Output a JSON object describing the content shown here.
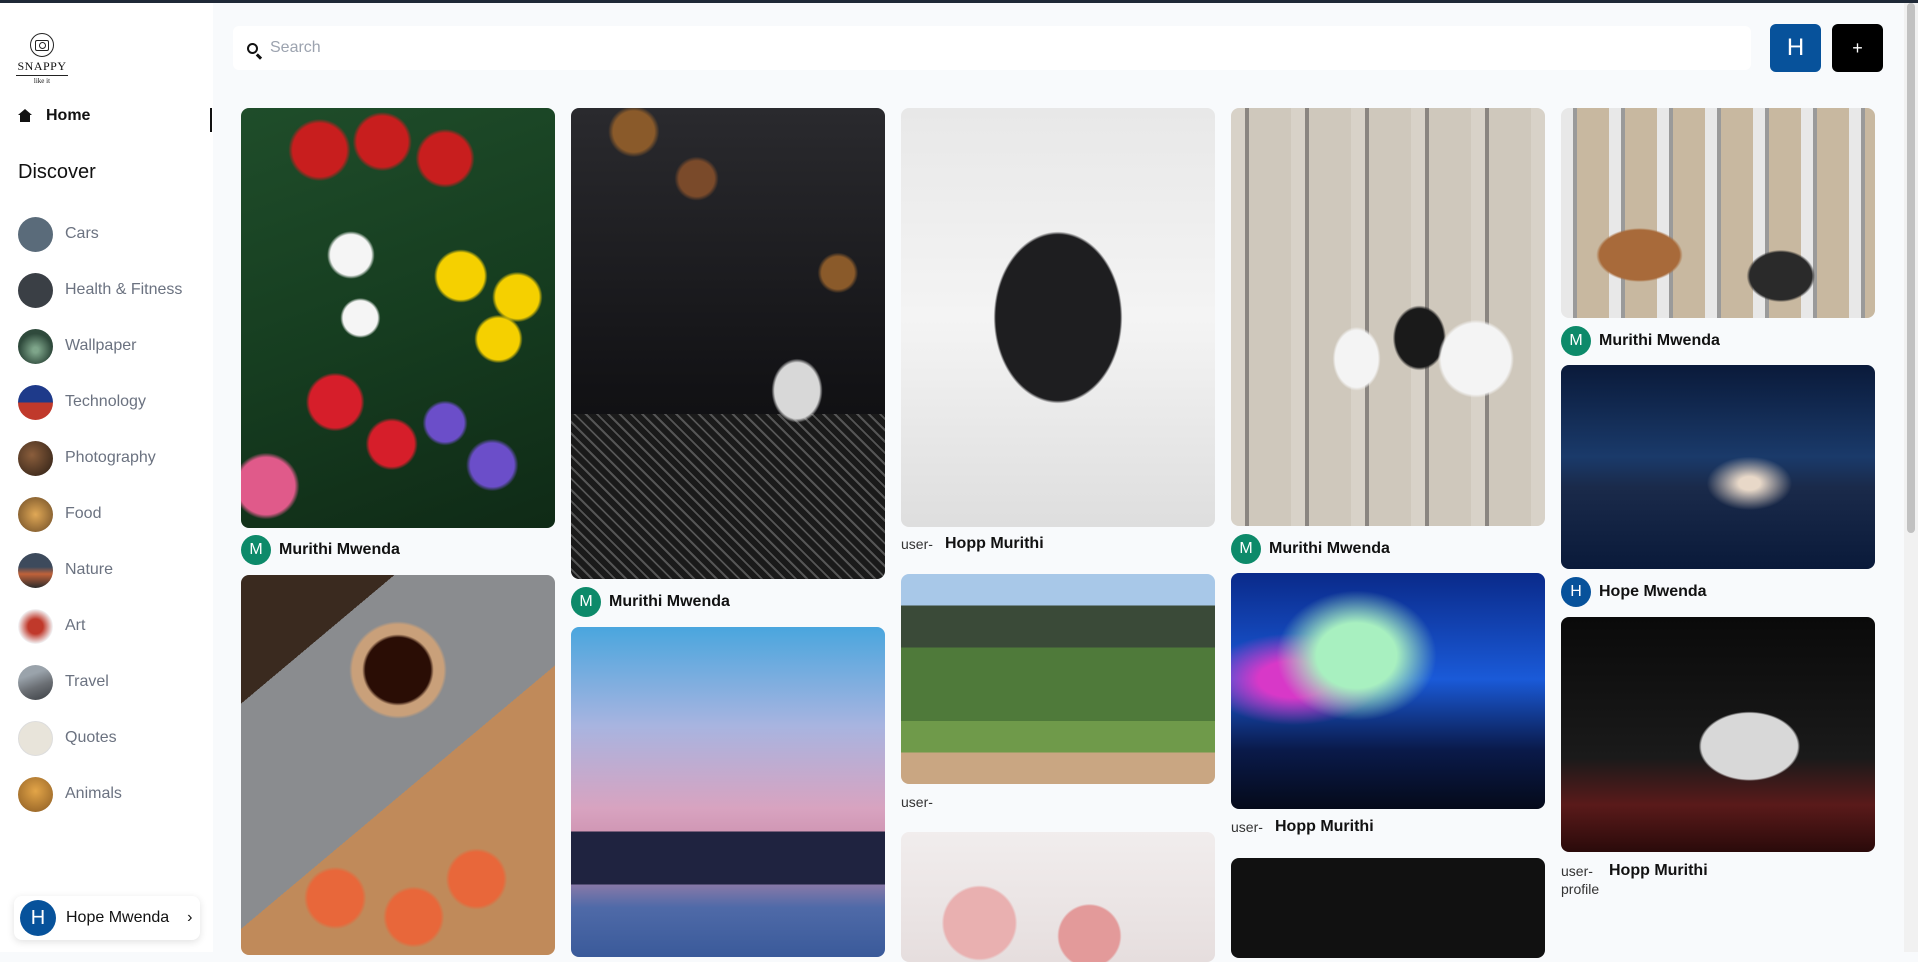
{
  "brand": {
    "name": "SNAPPY",
    "tagline": "like it"
  },
  "nav": {
    "home_label": "Home",
    "discover_title": "Discover"
  },
  "categories": [
    {
      "label": "Cars",
      "color": "#5a6b7a"
    },
    {
      "label": "Health & Fitness",
      "color": "#3a3f45"
    },
    {
      "label": "Wallpaper",
      "color": "#2f4a3c"
    },
    {
      "label": "Technology",
      "color": "#1e3a8a"
    },
    {
      "label": "Photography",
      "color": "#4a3426"
    },
    {
      "label": "Food",
      "color": "#b07a3a"
    },
    {
      "label": "Nature",
      "color": "#a0522d"
    },
    {
      "label": "Art",
      "color": "#c0392b"
    },
    {
      "label": "Travel",
      "color": "#6b6f74"
    },
    {
      "label": "Quotes",
      "color": "#e8e4da"
    },
    {
      "label": "Animals",
      "color": "#c98a3a"
    }
  ],
  "current_user": {
    "initial": "H",
    "name": "Hope Mwenda",
    "chevron": "›"
  },
  "search": {
    "placeholder": "Search"
  },
  "header": {
    "user_initial": "H",
    "add_label": "+"
  },
  "pins": [
    {
      "author": "Murithi Mwenda",
      "initial": "M",
      "avatar_color": "#0d8a6a"
    },
    {
      "author": "Murithi Mwenda",
      "initial": "M",
      "avatar_color": "#0d8a6a"
    },
    {
      "author": "Hopp Murithi",
      "broken_alt": "user-"
    },
    {
      "author": "Murithi Mwenda",
      "initial": "M",
      "avatar_color": "#0d8a6a"
    },
    {
      "author": "Murithi Mwenda",
      "initial": "M",
      "avatar_color": "#0d8a6a"
    },
    {
      "author": "Hope Mwenda",
      "initial": "H",
      "avatar_color": "#07529b"
    },
    {
      "author": "Hopp Murithi",
      "broken_alt": "user-"
    },
    {
      "author": "Hopp Murithi",
      "broken_alt": "user-profile"
    }
  ],
  "broken_images": [
    {
      "alt": "user-"
    }
  ]
}
